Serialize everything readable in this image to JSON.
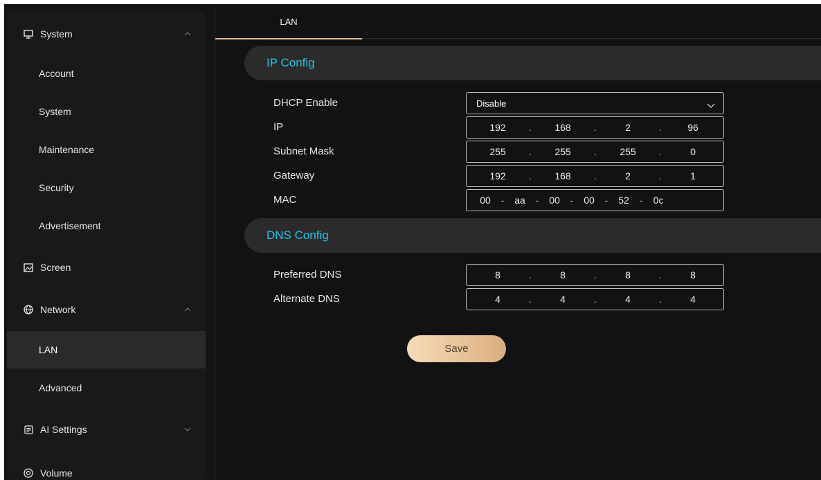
{
  "sidebar": {
    "items": [
      {
        "label": "System",
        "icon": "monitor-icon",
        "type": "group",
        "expanded": true
      },
      {
        "label": "Account",
        "type": "sub"
      },
      {
        "label": "System",
        "type": "sub"
      },
      {
        "label": "Maintenance",
        "type": "sub"
      },
      {
        "label": "Security",
        "type": "sub"
      },
      {
        "label": "Advertisement",
        "type": "sub"
      },
      {
        "label": "Screen",
        "icon": "image-icon",
        "type": "group"
      },
      {
        "label": "Network",
        "icon": "globe-icon",
        "type": "group",
        "expanded": true
      },
      {
        "label": "LAN",
        "type": "sub",
        "active": true
      },
      {
        "label": "Advanced",
        "type": "sub"
      },
      {
        "label": "AI Settings",
        "icon": "ai-chip-icon",
        "type": "group",
        "expanded": false
      },
      {
        "label": "Volume",
        "icon": "volume-icon",
        "type": "group"
      }
    ]
  },
  "tabs": [
    {
      "label": "LAN",
      "active": true
    }
  ],
  "ip_config": {
    "title": "IP Config",
    "dhcp_label": "DHCP Enable",
    "dhcp_value": "Disable",
    "ip_label": "IP",
    "ip": [
      "192",
      "168",
      "2",
      "96"
    ],
    "subnet_label": "Subnet Mask",
    "subnet": [
      "255",
      "255",
      "255",
      "0"
    ],
    "gateway_label": "Gateway",
    "gateway": [
      "192",
      "168",
      "2",
      "1"
    ],
    "mac_label": "MAC",
    "mac": [
      "00",
      "aa",
      "00",
      "00",
      "52",
      "0c"
    ]
  },
  "dns_config": {
    "title": "DNS Config",
    "preferred_label": "Preferred DNS",
    "preferred": [
      "8",
      "8",
      "8",
      "8"
    ],
    "alternate_label": "Alternate DNS",
    "alternate": [
      "4",
      "4",
      "4",
      "4"
    ]
  },
  "separators": {
    "ip": ".",
    "mac": "-"
  },
  "actions": {
    "save_label": "Save"
  },
  "colors": {
    "accent": "#27c3e6",
    "save_button": "#e6c195",
    "tab_underline": "#e0b88a"
  }
}
